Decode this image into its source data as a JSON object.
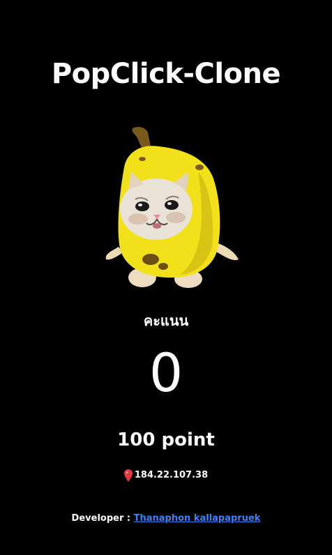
{
  "header": {
    "title": "PopClick-Clone"
  },
  "clicker": {
    "image_icon": "banana-cat-icon"
  },
  "score": {
    "label": "คะแนน",
    "value": "0",
    "points_text": "100 point"
  },
  "location": {
    "icon": "location-pin-icon",
    "ip": "184.22.107.38"
  },
  "footer": {
    "developer_label": "Developer :",
    "developer_name": "Thanaphon kallapapruek"
  },
  "colors": {
    "background": "#000000",
    "text": "#ffffff",
    "link": "#3b82f6",
    "banana_yellow": "#f2e01a",
    "pin_red": "#e53946"
  }
}
